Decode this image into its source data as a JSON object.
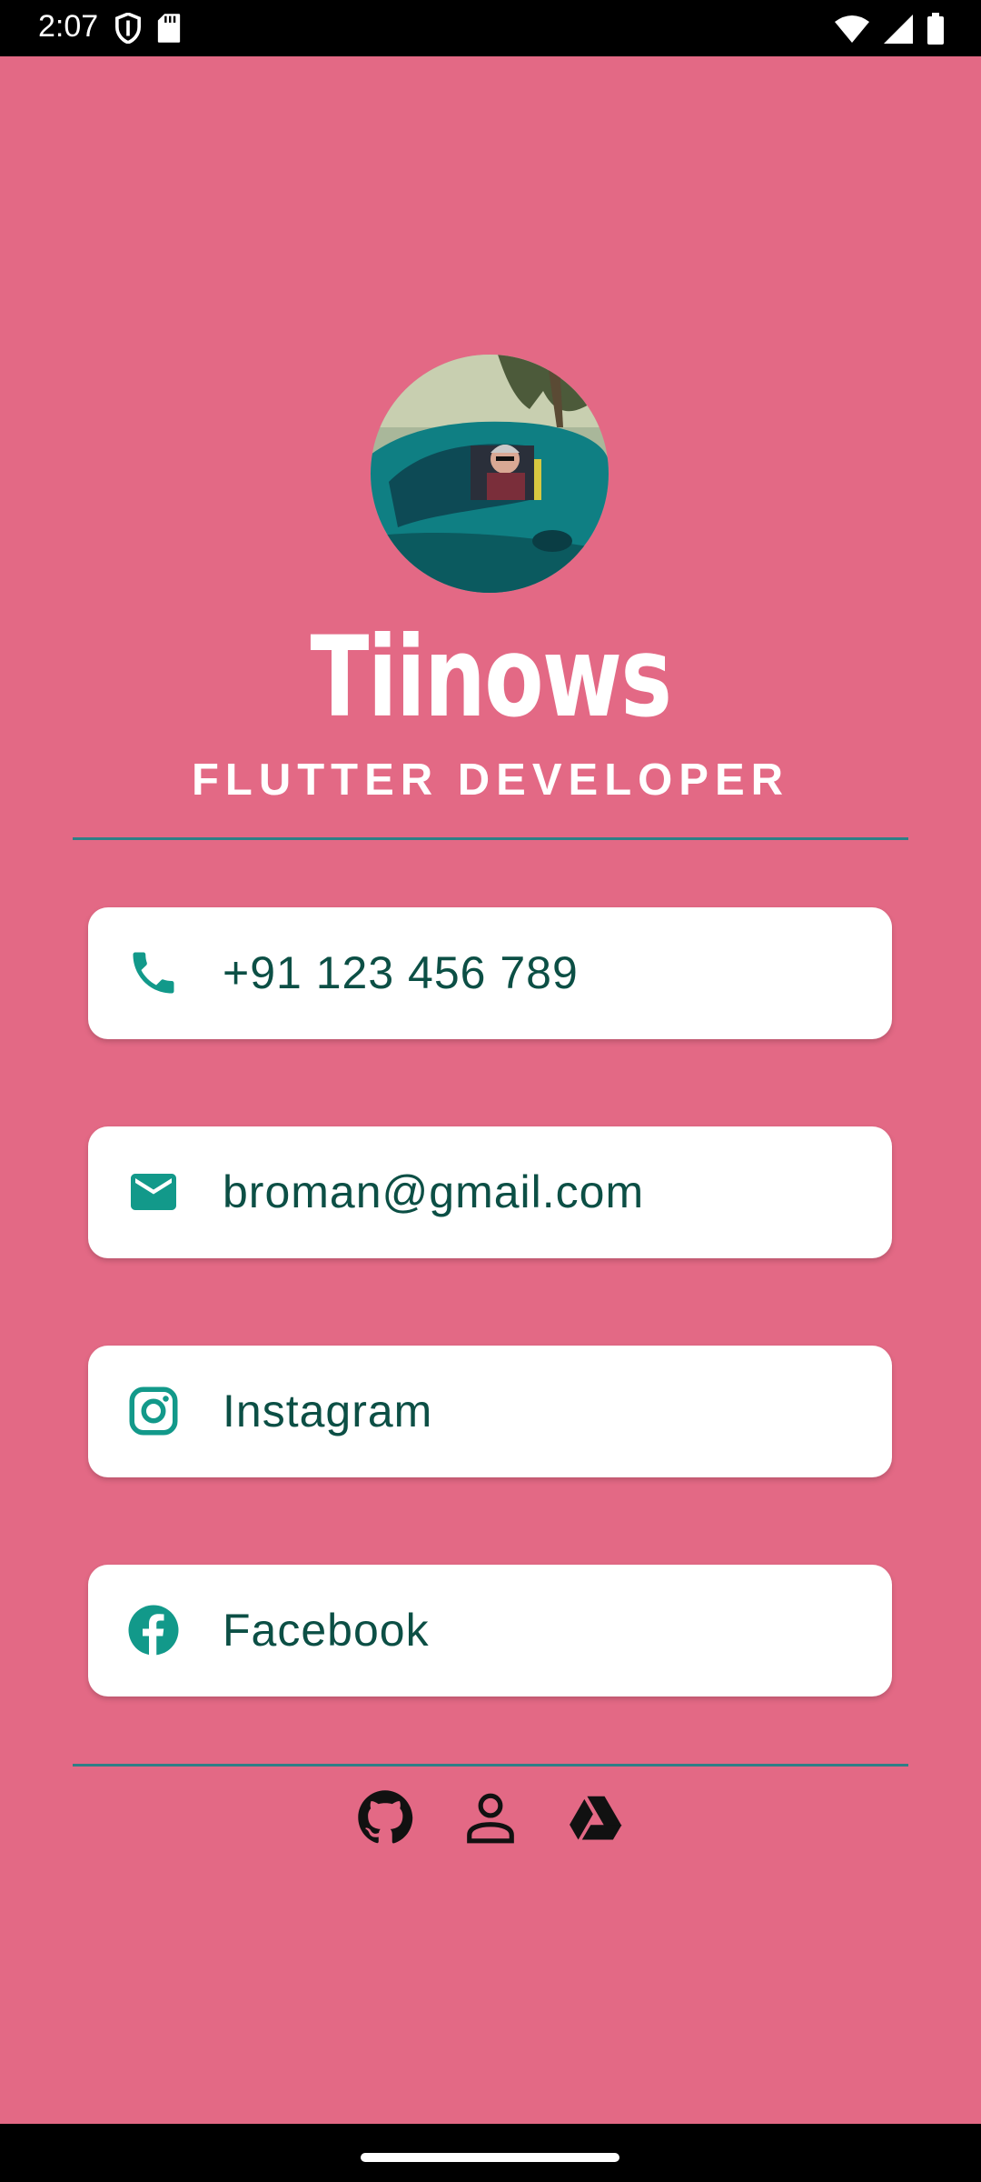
{
  "status_bar": {
    "time": "2:07",
    "left_icons": [
      "shield-icon",
      "sd-card-icon"
    ],
    "right_icons": [
      "wifi-icon",
      "signal-icon",
      "battery-icon"
    ]
  },
  "profile": {
    "name": "Tiinows",
    "title": "FLUTTER DEVELOPER"
  },
  "contacts": [
    {
      "icon": "phone-icon",
      "label": "+91 123 456 789"
    },
    {
      "icon": "email-icon",
      "label": "broman@gmail.com"
    },
    {
      "icon": "instagram-icon",
      "label": "Instagram"
    },
    {
      "icon": "facebook-icon",
      "label": "Facebook"
    }
  ],
  "footer_links": [
    "github-icon",
    "person-icon",
    "google-drive-icon"
  ],
  "colors": {
    "background": "#e36985",
    "divider": "#2f7f86",
    "card": "#ffffff",
    "card_text": "#0c4f45",
    "icon_accent": "#12998a"
  }
}
